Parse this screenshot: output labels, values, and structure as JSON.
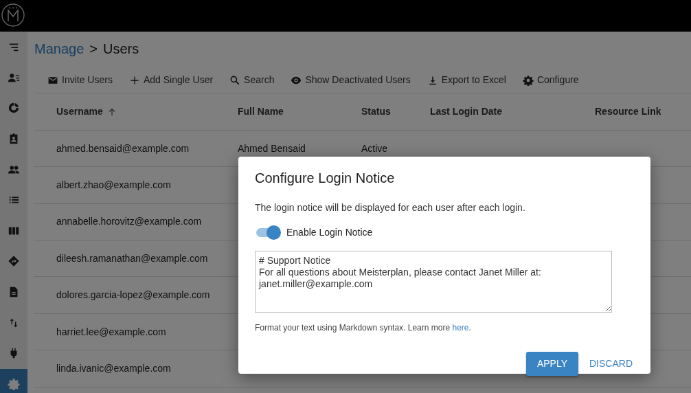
{
  "sidebar": {
    "items": [
      {
        "kind": "menu",
        "selected": false
      },
      {
        "kind": "user-list",
        "selected": false
      },
      {
        "kind": "donut",
        "selected": false
      },
      {
        "kind": "badge",
        "selected": false
      },
      {
        "kind": "people",
        "selected": false
      },
      {
        "kind": "list",
        "selected": false
      },
      {
        "kind": "columns",
        "selected": false
      },
      {
        "kind": "route",
        "selected": false
      },
      {
        "kind": "document",
        "selected": false
      },
      {
        "kind": "swap",
        "selected": false
      },
      {
        "kind": "plug",
        "selected": false
      },
      {
        "kind": "gear",
        "selected": true
      }
    ]
  },
  "breadcrumb": {
    "parent": "Manage",
    "separator": ">",
    "current": "Users"
  },
  "toolbar": [
    {
      "kind": "mail",
      "label": "Invite Users"
    },
    {
      "kind": "plus",
      "label": "Add Single User"
    },
    {
      "kind": "search",
      "label": "Search"
    },
    {
      "kind": "eye",
      "label": "Show Deactivated Users"
    },
    {
      "kind": "download",
      "label": "Export to Excel"
    },
    {
      "kind": "gear",
      "label": "Configure"
    }
  ],
  "table": {
    "columns": [
      {
        "label": "Username",
        "sorted": true
      },
      {
        "label": "Full Name",
        "sorted": false
      },
      {
        "label": "Status",
        "sorted": false
      },
      {
        "label": "Last Login Date",
        "sorted": false
      },
      {
        "label": "Resource Link",
        "sorted": false
      }
    ],
    "rows": [
      {
        "username": "ahmed.bensaid@example.com",
        "full_name": "Ahmed Bensaid",
        "status": "Active"
      },
      {
        "username": "albert.zhao@example.com"
      },
      {
        "username": "annabelle.horovitz@example.com"
      },
      {
        "username": "dileesh.ramanathan@example.com"
      },
      {
        "username": "dolores.garcia-lopez@example.com"
      },
      {
        "username": "harriet.lee@example.com"
      },
      {
        "username": "linda.ivanic@example.com"
      }
    ]
  },
  "dialog": {
    "title": "Configure Login Notice",
    "description": "The login notice will be displayed for each user after each login.",
    "toggle": {
      "label": "Enable Login Notice",
      "on": true
    },
    "notice_text": "# Support Notice\nFor all questions about Meisterplan, please contact Janet Miller at:\njanet.miller@example.com",
    "hint": "Format your text using Markdown syntax. Learn more",
    "hint_link": "here",
    "hint_end": ".",
    "buttons": [
      {
        "kind": "primary",
        "label": "APPLY"
      },
      {
        "kind": "text",
        "label": "DISCARD"
      }
    ]
  }
}
